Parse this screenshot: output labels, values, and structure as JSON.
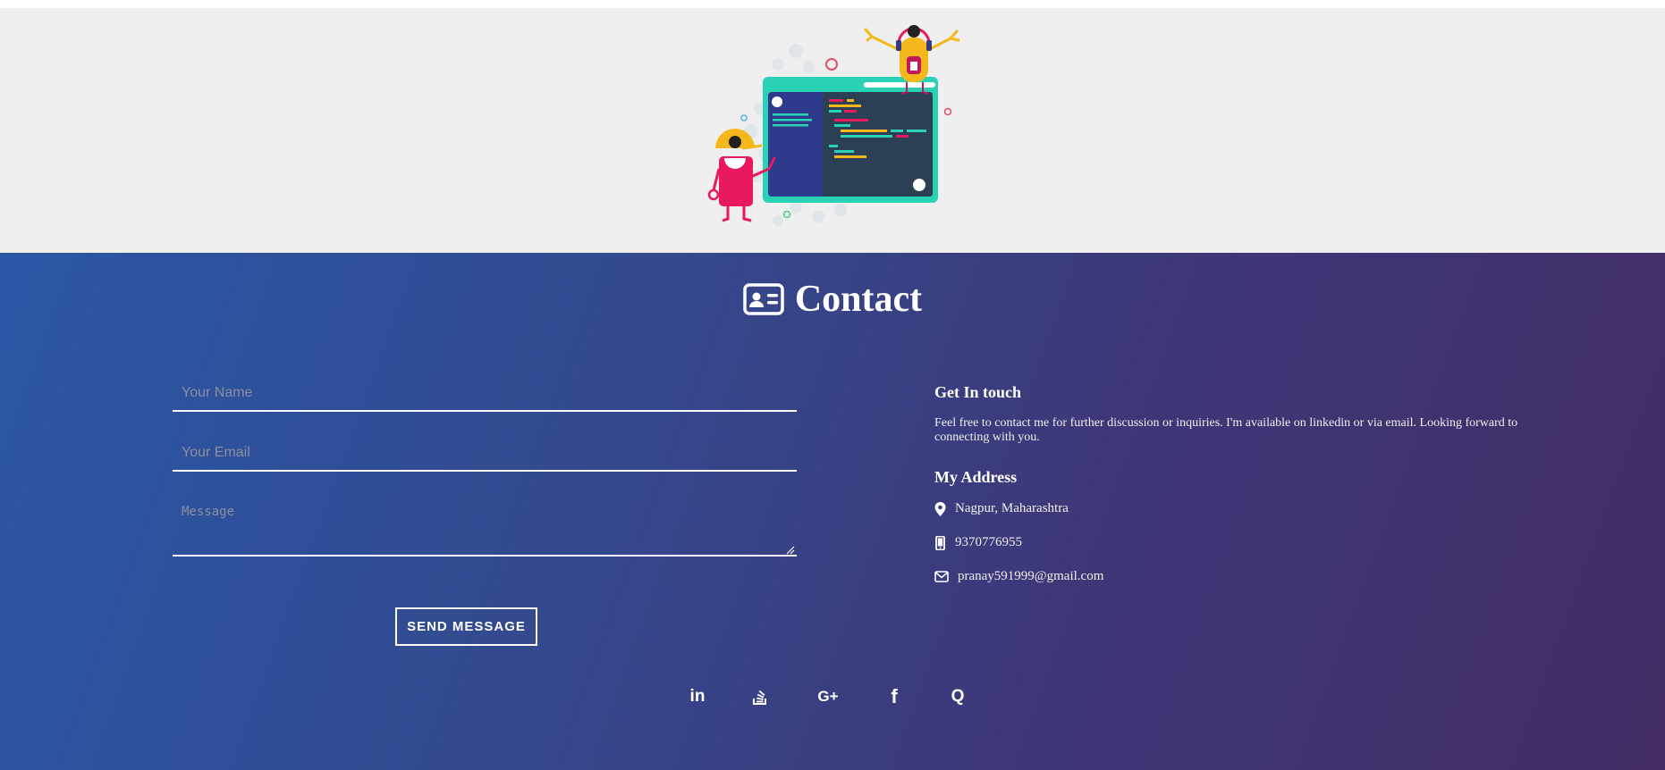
{
  "illustration": {
    "name": "developer-illustration"
  },
  "contact": {
    "title": "Contact",
    "icon": "contact-card-icon"
  },
  "form": {
    "name_placeholder": "Your Name",
    "email_placeholder": "Your Email",
    "message_placeholder": "Message",
    "submit_label": "SEND MESSAGE"
  },
  "info": {
    "heading": "Get In touch",
    "description": "Feel free to contact me for further discussion or inquiries. I'm available on linkedin or via email. Looking forward to connecting with you.",
    "address_heading": "My Address",
    "location": "Nagpur, Maharashtra",
    "phone": "9370776955",
    "email": "pranay591999@gmail.com"
  },
  "socials": {
    "linkedin": "in",
    "stackoverflow": "stackoverflow-icon",
    "googleplus": "G+",
    "facebook": "f",
    "quora": "Q"
  },
  "colors": {
    "gradient_start": "#2a57a6",
    "gradient_end": "#432d65",
    "hero_bg": "#efefef"
  }
}
